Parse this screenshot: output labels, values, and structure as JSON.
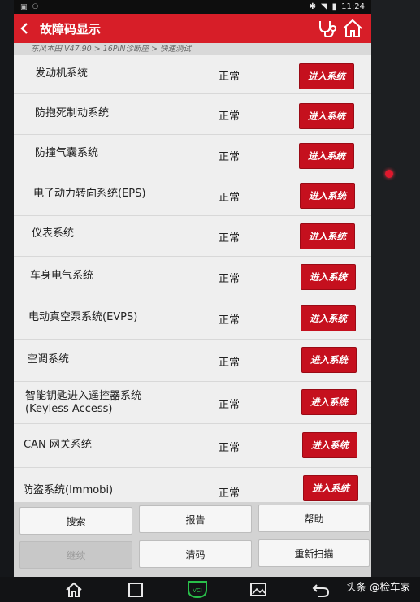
{
  "status_bar": {
    "time": "11:24"
  },
  "header": {
    "title": "故障码显示"
  },
  "breadcrumb": "东风本田 V47.90 > 16PIN诊断座 > 快速测试",
  "systems": [
    {
      "name": "发动机系统",
      "status": "正常",
      "button": "进入系统"
    },
    {
      "name": "防抱死制动系统",
      "status": "正常",
      "button": "进入系统"
    },
    {
      "name": "防撞气囊系统",
      "status": "正常",
      "button": "进入系统"
    },
    {
      "name": "电子动力转向系统(EPS)",
      "status": "正常",
      "button": "进入系统"
    },
    {
      "name": "仪表系统",
      "status": "正常",
      "button": "进入系统"
    },
    {
      "name": "车身电气系统",
      "status": "正常",
      "button": "进入系统"
    },
    {
      "name": "电动真空泵系统(EVPS)",
      "status": "正常",
      "button": "进入系统"
    },
    {
      "name": "空调系统",
      "status": "正常",
      "button": "进入系统"
    },
    {
      "name": "智能钥匙进入遥控器系统",
      "name2": "(Keyless Access)",
      "status": "正常",
      "button": "进入系统"
    },
    {
      "name": "CAN 网关系统",
      "status": "正常",
      "button": "进入系统"
    },
    {
      "name": "防盗系统(Immobi)",
      "status": "正常",
      "button": "进入系统"
    }
  ],
  "bottom_buttons": {
    "search": "搜索",
    "report": "报告",
    "help": "帮助",
    "continue": "继续",
    "clear": "清码",
    "rescan": "重新扫描"
  },
  "nav": {
    "vci_label": "VCI"
  },
  "watermark": "头条 @检车家",
  "colors": {
    "header_red": "#d71e28",
    "button_red": "#c5101e"
  }
}
